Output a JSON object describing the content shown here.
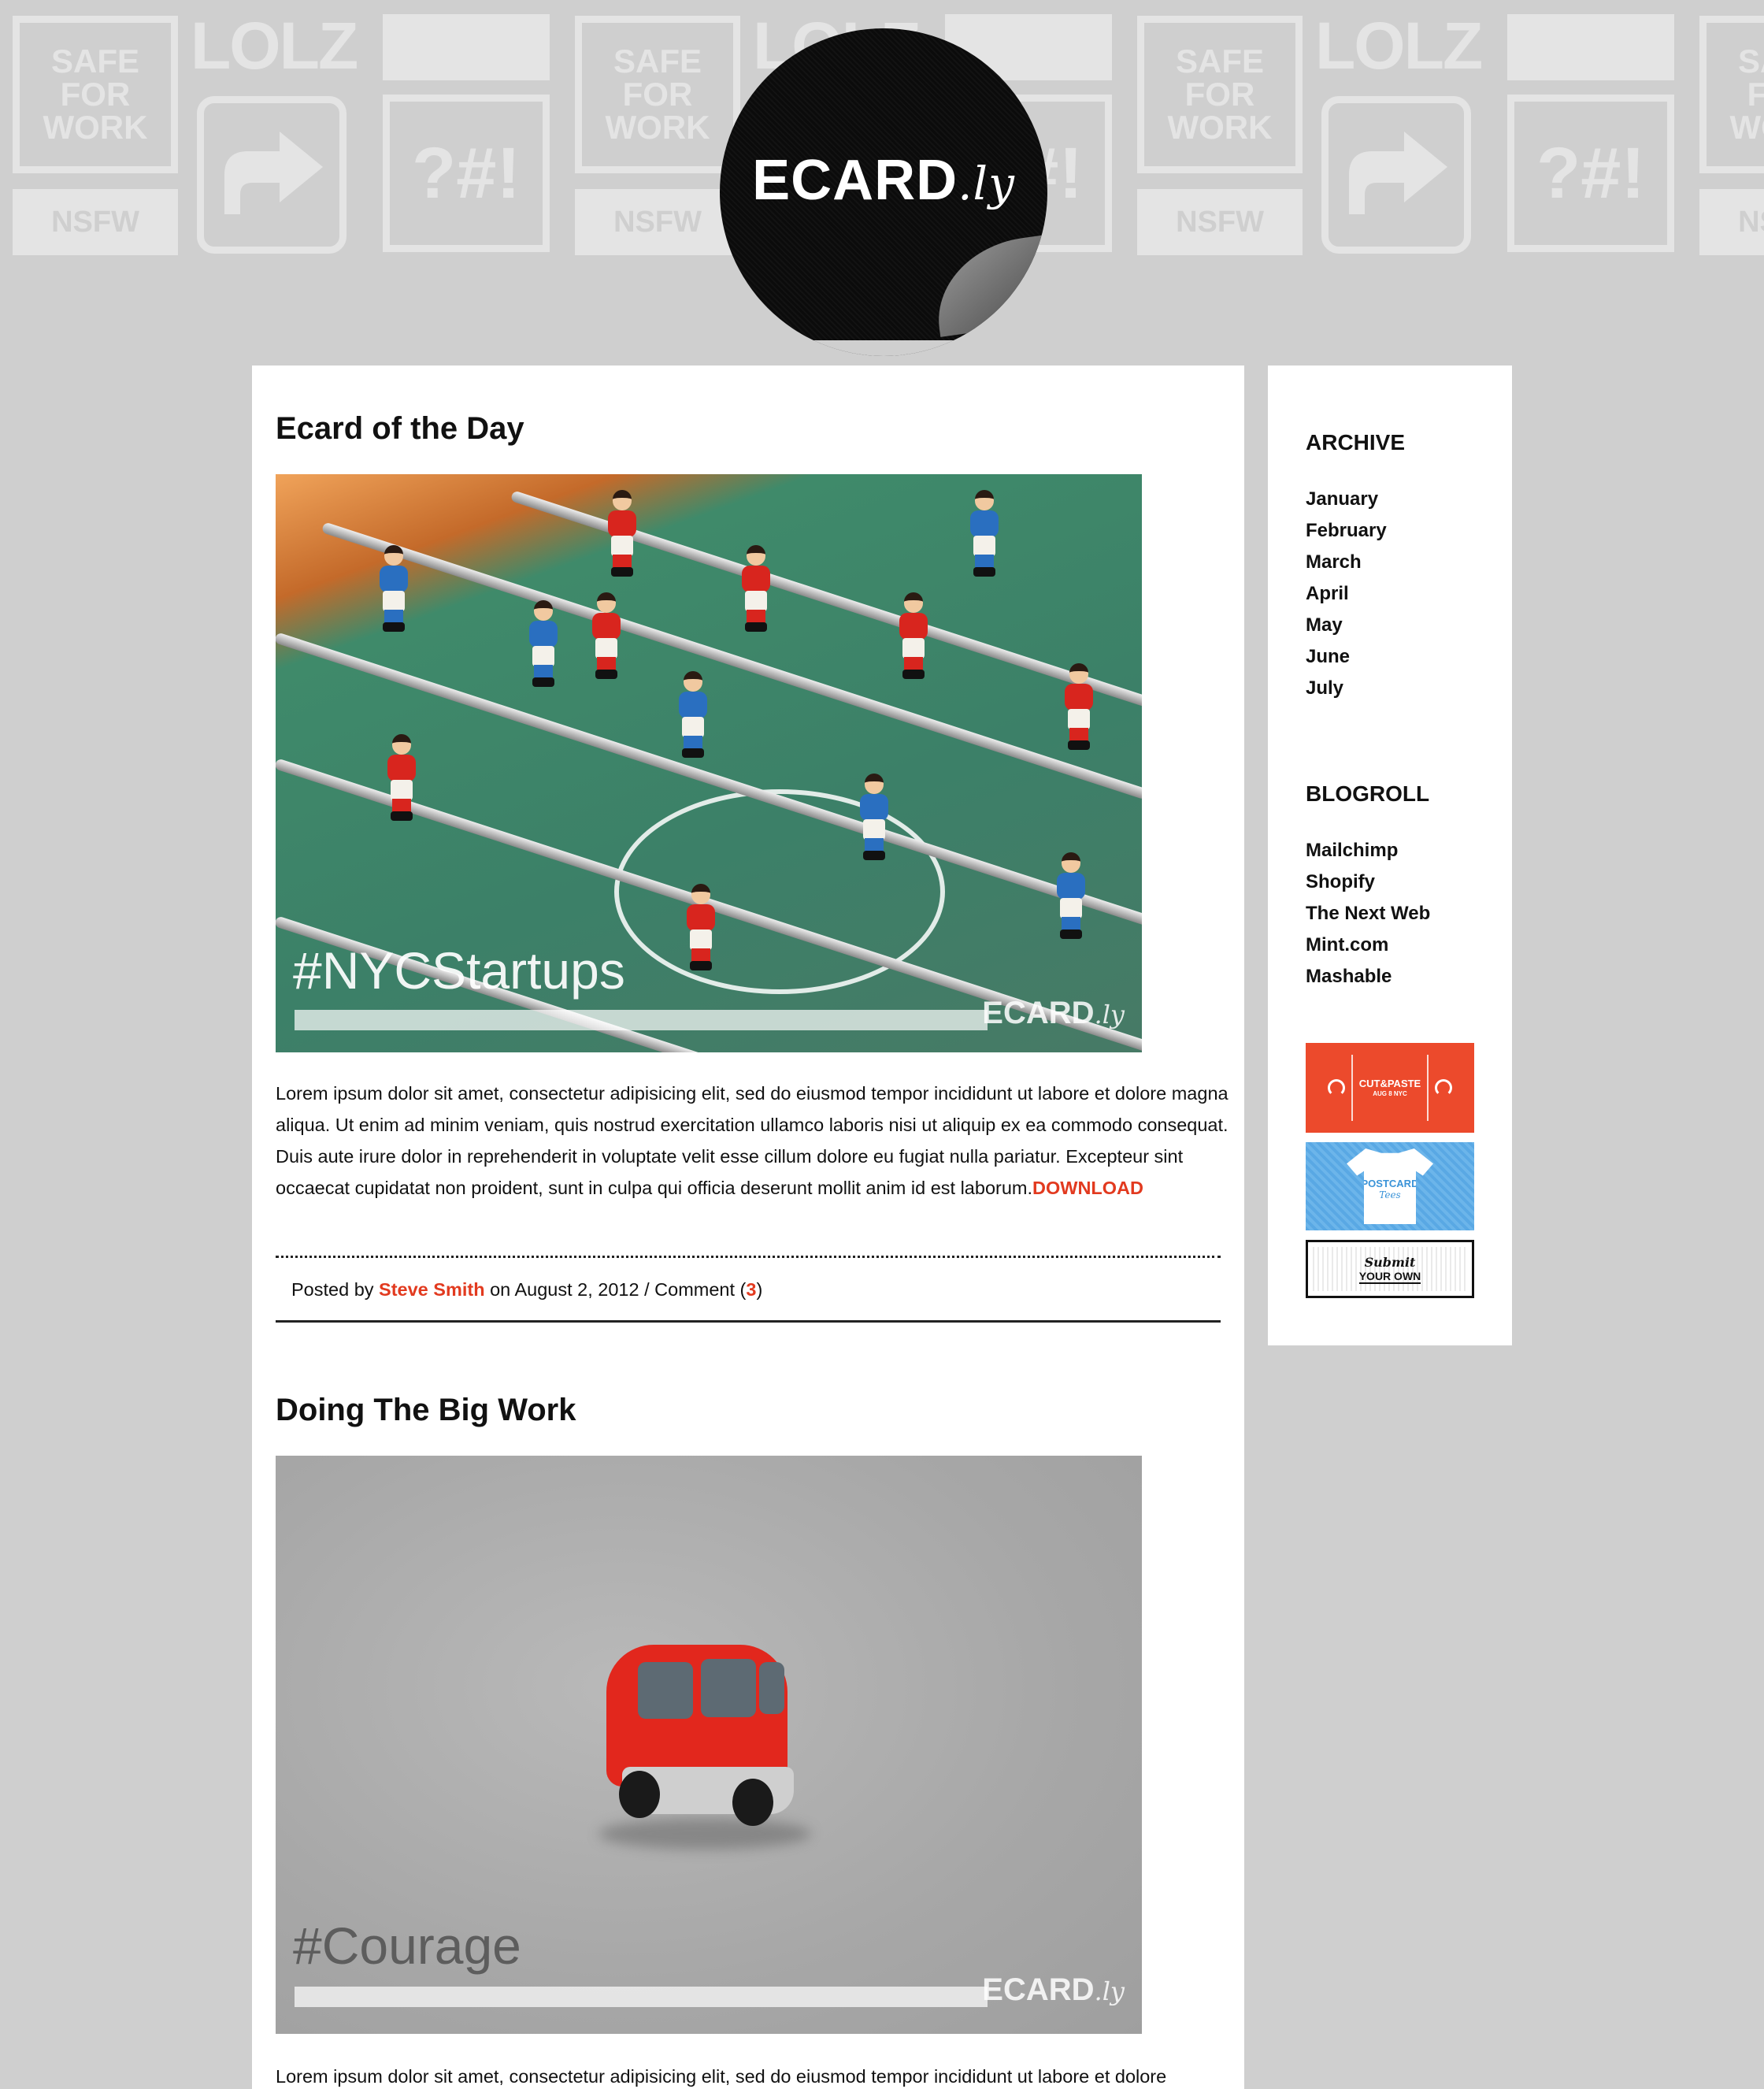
{
  "header": {
    "pattern_tiles": {
      "safe": "SAFE\nFOR\nWORK",
      "lolz": "LOLZ",
      "symbols": "?#!",
      "nsfw": "NSFW"
    },
    "logo_text": "ECARD",
    "logo_suffix": ".ly"
  },
  "posts": [
    {
      "title": "Ecard of the Day",
      "image_tag": "#NYCStartups",
      "image_brand": "ECARD",
      "image_brand_suffix": ".ly",
      "body": "Lorem ipsum dolor sit amet, consectetur adipisicing elit, sed do eiusmod tempor incididunt ut labore et dolore magna aliqua. Ut enim ad minim veniam, quis nostrud exercitation ullamco laboris nisi ut aliquip ex ea commodo consequat. Duis aute irure dolor in reprehenderit in voluptate velit esse cillum dolore eu fugiat nulla pariatur. Excepteur sint occaecat cupidatat non proident, sunt in culpa qui officia deserunt mollit anim id est laborum.",
      "download_label": "DOWNLOAD",
      "meta_prefix": "Posted by ",
      "author": "Steve Smith",
      "meta_middle": " on August 2, 2012 / Comment (",
      "comment_count": "3",
      "meta_suffix": ")"
    },
    {
      "title": "Doing The Big Work",
      "image_tag": "#Courage",
      "image_brand": "ECARD",
      "image_brand_suffix": ".ly",
      "body": "Lorem ipsum dolor sit amet, consectetur adipisicing elit, sed do eiusmod tempor incididunt ut labore et dolore"
    }
  ],
  "sidebar": {
    "archive_heading": "ARCHIVE",
    "archive": [
      "January",
      "February",
      "March",
      "April",
      "May",
      "June",
      "July"
    ],
    "blogroll_heading": "BLOGROLL",
    "blogroll": [
      "Mailchimp",
      "Shopify",
      "The Next Web",
      "Mint.com",
      "Mashable"
    ],
    "banners": {
      "cut_paste": "CUT&PASTE",
      "cut_paste_sub": "AUG 8 NYC",
      "postcard": "POSTCARD",
      "postcard_sub": "Tees",
      "submit_1": "Submit",
      "submit_2": "YOUR OWN"
    }
  },
  "colors": {
    "background": "#cfcfcf",
    "accent": "#e23a1f",
    "banner_orange": "#ec4a2c",
    "banner_blue": "#59a8e4"
  }
}
